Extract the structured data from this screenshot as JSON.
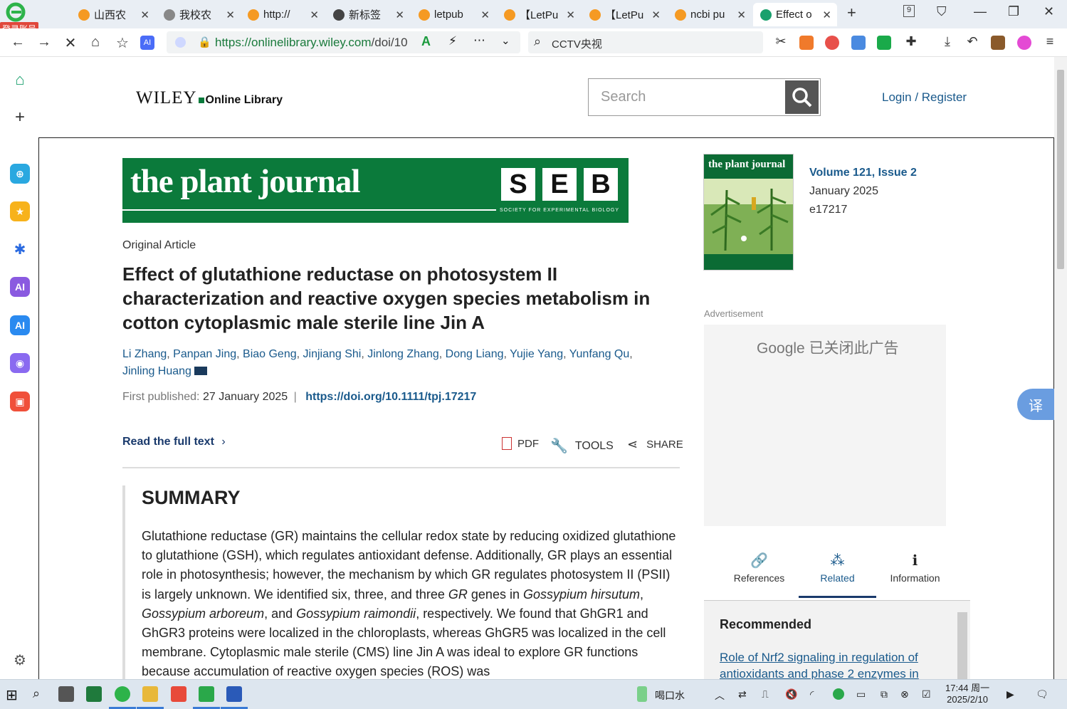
{
  "browser": {
    "login_badge": "登录账号",
    "tabs": [
      {
        "title": "山西农",
        "icon_color": "#f59a23"
      },
      {
        "title": "我校农",
        "icon_color": "#888888"
      },
      {
        "title": "http://",
        "icon_color": "#f59a23"
      },
      {
        "title": "新标签",
        "icon_color": "#444444"
      },
      {
        "title": "letpub",
        "icon_color": "#f59a23"
      },
      {
        "title": "【LetPu",
        "icon_color": "#f59a23"
      },
      {
        "title": "【LetPu",
        "icon_color": "#f59a23"
      },
      {
        "title": "ncbi pu",
        "icon_color": "#f59a23"
      },
      {
        "title": "Effect o",
        "icon_color": "#1aa06d"
      }
    ],
    "new_tab": "+",
    "tab_counter": "9",
    "url_host": "https://onlinelibrary.wiley.com",
    "url_rest": "/doi/10",
    "search_query": "CCTV央视"
  },
  "site": {
    "logo_main": "WILEY",
    "logo_sub": "Online Library",
    "search_placeholder": "Search",
    "login": "Login / Register"
  },
  "banner": {
    "journal": "the plant journal",
    "seb": [
      "S",
      "E",
      "B"
    ],
    "seb_sub": "SOCIETY FOR EXPERIMENTAL BIOLOGY"
  },
  "article": {
    "type": "Original Article",
    "title": "Effect of glutathione reductase on photosystem II characterization and reactive oxygen species metabolism in cotton cytoplasmic male sterile line Jin A",
    "authors": [
      "Li Zhang",
      "Panpan Jing",
      "Biao Geng",
      "Jinjiang Shi",
      "Jinlong Zhang",
      "Dong Liang",
      "Yujie Yang",
      "Yunfang Qu",
      "Jinling Huang"
    ],
    "first_published_label": "First published:",
    "first_published": "27 January 2025",
    "doi": "https://doi.org/10.1111/tpj.17217",
    "read_full": "Read the full text",
    "pdf": "PDF",
    "tools": "TOOLS",
    "share": "SHARE",
    "summary_heading": "SUMMARY",
    "summary_parts": [
      "Glutathione reductase (GR) maintains the cellular redox state by reducing oxidized glutathione to glutathione (GSH), which regulates antioxidant defense. Additionally, GR plays an essential role in photosynthesis; however, the mechanism by which GR regulates photosystem II (PSII) is largely unknown. We identified six, three, and three ",
      "GR",
      " genes in ",
      "Gossypium hirsutum",
      ", ",
      "Gossypium arboreum",
      ", and ",
      "Gossypium raimondii",
      ", respectively. We found that GhGR1 and GhGR3 proteins were localized in the chloroplasts, whereas GhGR5 was localized in the cell membrane. Cytoplasmic male sterile (CMS) line Jin A was ideal to explore GR functions because accumulation of reactive oxygen species (ROS) was"
    ]
  },
  "sidebar_right": {
    "cover_title": "the plant journal",
    "volume": "Volume 121, Issue 2",
    "date": "January 2025",
    "eid": "e17217",
    "ad_label": "Advertisement",
    "ad_google": "Google",
    "ad_closed": "已关闭此广告",
    "tabs": [
      {
        "label": "References",
        "icon": "link-icon"
      },
      {
        "label": "Related",
        "icon": "related-icon"
      },
      {
        "label": "Information",
        "icon": "info-icon"
      }
    ],
    "recommended_heading": "Recommended",
    "recommended_link": "Role of Nrf2 signaling in regulation of antioxidants and phase 2 enzymes in"
  },
  "translate": "译",
  "taskbar": {
    "weather": "喝口水",
    "time": "17:44 周一",
    "date": "2025/2/10"
  }
}
